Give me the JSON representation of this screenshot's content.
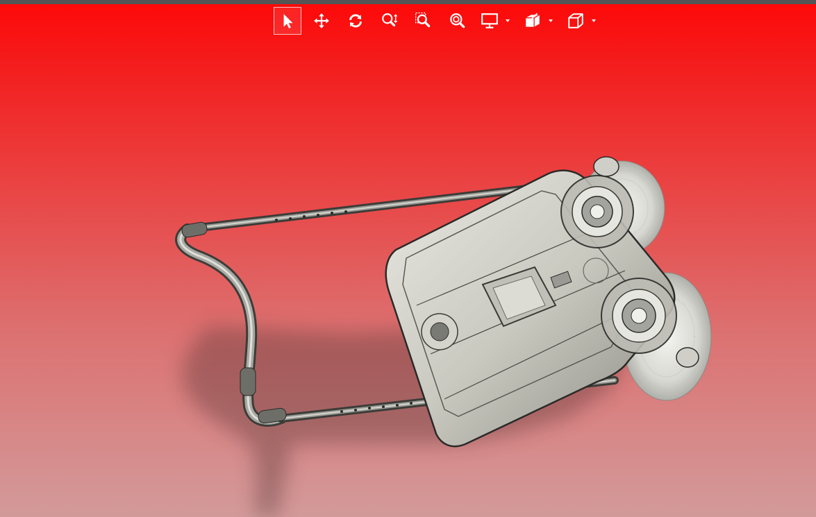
{
  "app": {
    "accent_color": "#ff0808",
    "background_bottom_color": "#d39a9a"
  },
  "toolbar": {
    "tools": [
      {
        "id": "select",
        "icon": "arrow-cursor-icon",
        "active": true
      },
      {
        "id": "pan",
        "icon": "move-arrows-icon",
        "active": false
      },
      {
        "id": "rotate",
        "icon": "rotate-arrows-icon",
        "active": false
      },
      {
        "id": "zoom",
        "icon": "zoom-updown-icon",
        "active": false
      },
      {
        "id": "zoom-window",
        "icon": "zoom-window-icon",
        "active": false
      },
      {
        "id": "zoom-fit",
        "icon": "zoom-fit-icon",
        "active": false
      },
      {
        "id": "display",
        "icon": "monitor-icon",
        "active": false,
        "has_dropdown": true
      },
      {
        "id": "section",
        "icon": "section-view-icon",
        "active": false,
        "has_dropdown": true
      },
      {
        "id": "view-orientation",
        "icon": "cube-icon",
        "active": false,
        "has_dropdown": true
      }
    ]
  },
  "scene": {
    "model": "machine-with-handle"
  }
}
